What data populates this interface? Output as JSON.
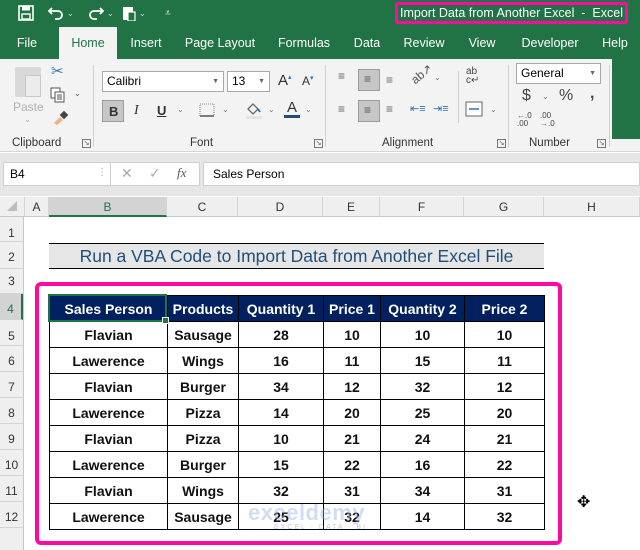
{
  "window": {
    "title": "Import Data from Another Excel  -  Excel",
    "accent": "#217346",
    "highlight": "#ff0aa0"
  },
  "quick_access": {
    "save_icon": "save-icon",
    "undo_icon": "undo-icon",
    "redo_icon": "redo-icon",
    "paste_icon": "paste-icon",
    "customize_icon": "customize-qat-icon"
  },
  "tabs": [
    {
      "label": "File"
    },
    {
      "label": "Home",
      "active": true
    },
    {
      "label": "Insert"
    },
    {
      "label": "Page Layout"
    },
    {
      "label": "Formulas"
    },
    {
      "label": "Data"
    },
    {
      "label": "Review"
    },
    {
      "label": "View"
    },
    {
      "label": "Developer"
    },
    {
      "label": "Help"
    }
  ],
  "ribbon": {
    "clipboard": {
      "label": "Clipboard",
      "paste_label": "Paste"
    },
    "font": {
      "label": "Font",
      "font_name": "Calibri",
      "font_size": "13",
      "bold": "B",
      "italic": "I",
      "underline": "U",
      "grow": "A",
      "shrink": "A",
      "font_color": "A"
    },
    "alignment": {
      "label": "Alignment",
      "wrap": "ab"
    },
    "number": {
      "label": "Number",
      "format": "General",
      "currency": "$",
      "percent": "%",
      "comma": ",",
      "inc_decimal": "←.0 .00",
      "dec_decimal": ".00 →.0"
    }
  },
  "formula_bar": {
    "name_box": "B4",
    "cancel": "✕",
    "enter": "✓",
    "fx": "fx",
    "value": "Sales Person"
  },
  "columns": [
    "A",
    "B",
    "C",
    "D",
    "E",
    "F",
    "G",
    "H"
  ],
  "rows": [
    "1",
    "2",
    "3",
    "4",
    "5",
    "6",
    "7",
    "8",
    "9",
    "10",
    "11",
    "12"
  ],
  "sheet": {
    "title": "Run a VBA Code to Import Data from Another Excel File",
    "table": {
      "headers": [
        "Sales Person",
        "Products",
        "Quantity 1",
        "Price 1",
        "Quantity 2",
        "Price 2"
      ],
      "rows": [
        [
          "Flavian",
          "Sausage",
          "28",
          "10",
          "10",
          "10"
        ],
        [
          "Lawerence",
          "Wings",
          "16",
          "11",
          "15",
          "11"
        ],
        [
          "Flavian",
          "Burger",
          "34",
          "12",
          "32",
          "12"
        ],
        [
          "Lawerence",
          "Pizza",
          "14",
          "20",
          "25",
          "20"
        ],
        [
          "Flavian",
          "Pizza",
          "10",
          "21",
          "24",
          "21"
        ],
        [
          "Lawerence",
          "Burger",
          "15",
          "22",
          "16",
          "22"
        ],
        [
          "Flavian",
          "Wings",
          "32",
          "31",
          "34",
          "31"
        ],
        [
          "Lawerence",
          "Sausage",
          "25",
          "32",
          "14",
          "32"
        ]
      ]
    }
  },
  "watermark": {
    "brand": "exceldemy",
    "tagline": "EXCEL · DATA · BI"
  }
}
